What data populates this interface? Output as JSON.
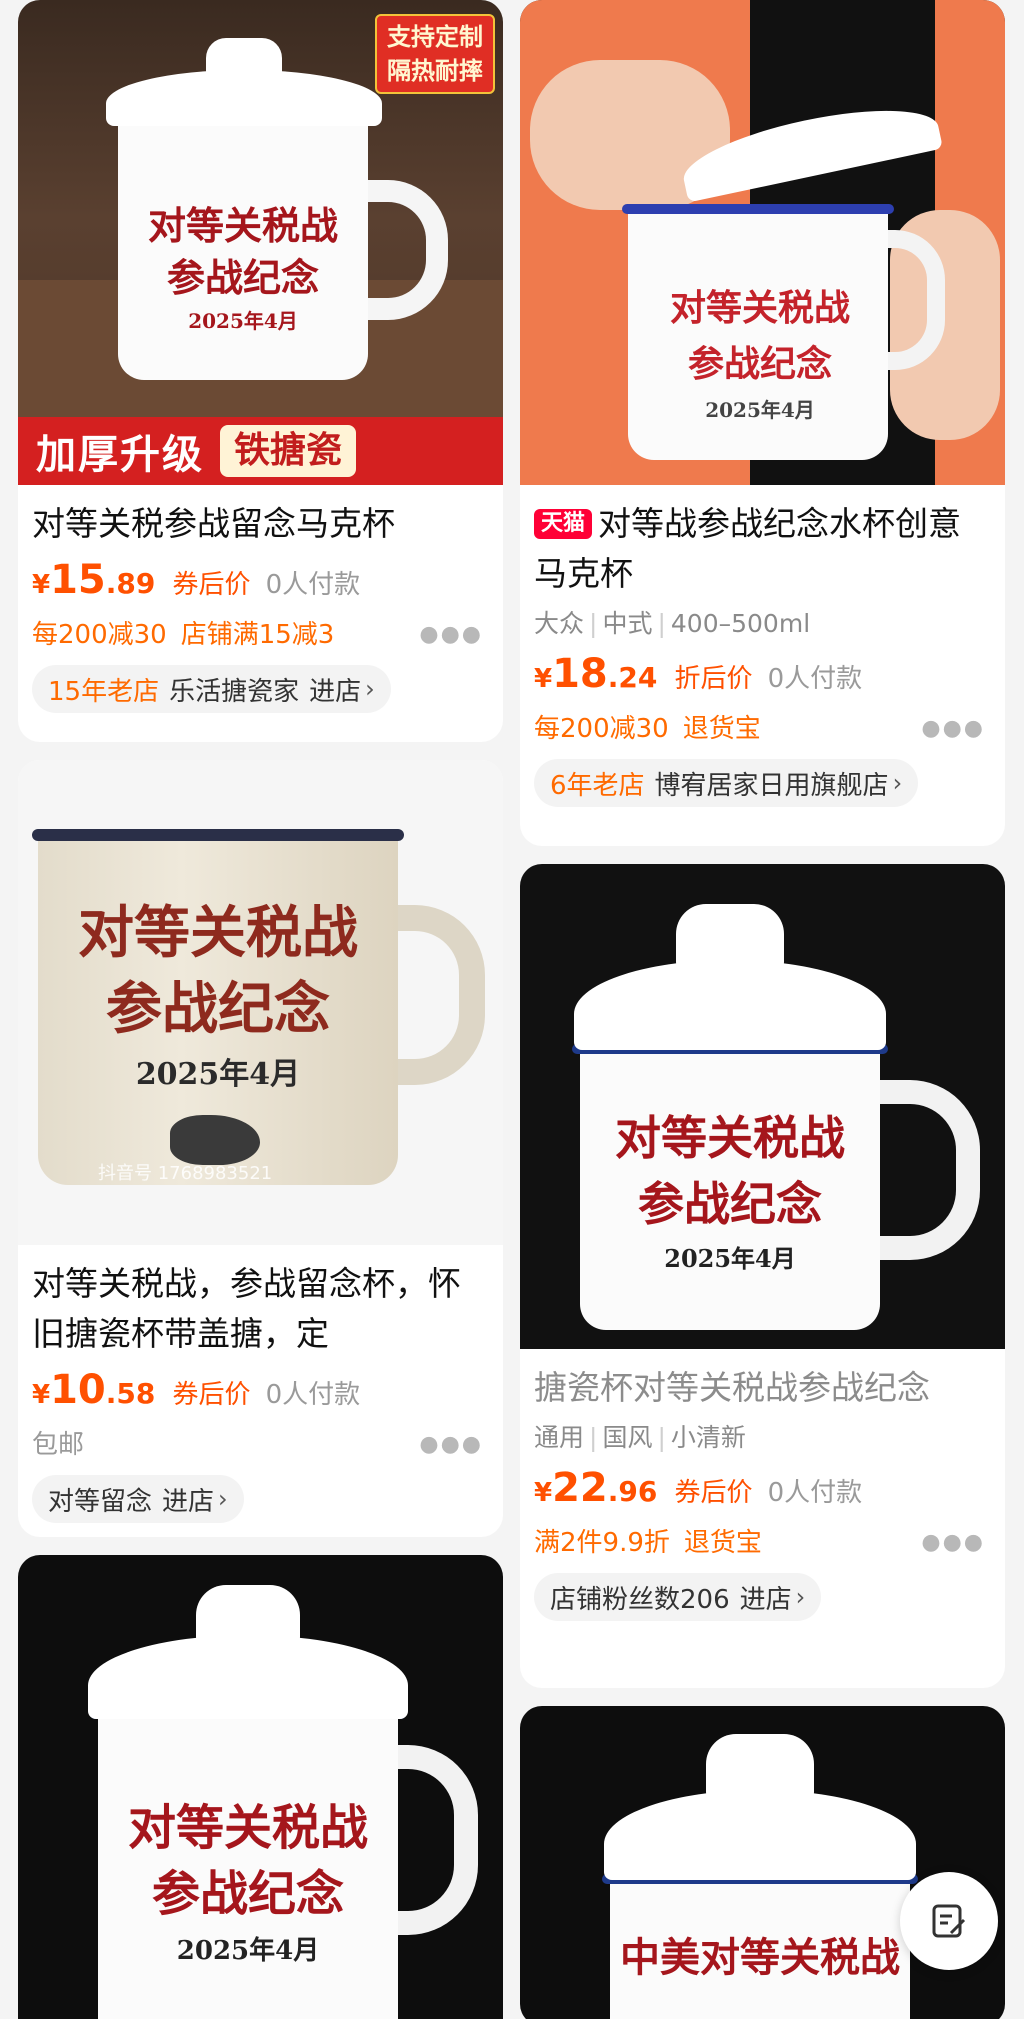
{
  "products": [
    {
      "title": "对等关税参战留念马克杯",
      "image_badge": [
        "支持定制",
        "隔热耐摔"
      ],
      "image_banner": [
        "加厚升级",
        "铁搪瓷"
      ],
      "mug_print": [
        "对等关税战",
        "参战纪念",
        "2025年4月"
      ],
      "price_yen": "¥",
      "price_int": "15",
      "price_dec": ".89",
      "price_label": "券后价",
      "sales": "0人付款",
      "promos": [
        "每200减30",
        "店铺满15减3"
      ],
      "shop_age": "15年老店",
      "shop_name": "乐活搪瓷家",
      "shop_enter": "进店"
    },
    {
      "title": "对等关税战，参战留念杯，怀旧搪瓷杯带盖搪，定",
      "mug_print": [
        "对等关税战",
        "参战纪念",
        "2025年4月"
      ],
      "watermark": "抖音号 1768983521",
      "price_yen": "¥",
      "price_int": "10",
      "price_dec": ".58",
      "price_label": "券后价",
      "sales": "0人付款",
      "promo_gray": "包邮",
      "shop_name": "对等留念",
      "shop_enter": "进店"
    },
    {
      "mug_print": [
        "对等关税战",
        "参战纪念",
        "2025年4月"
      ]
    },
    {
      "tmall_badge": "天猫",
      "title": "对等战参战纪念水杯创意马克杯",
      "tags": [
        "大众",
        "中式",
        "400–500ml"
      ],
      "mug_print": [
        "对等关税战",
        "参战纪念",
        "2025年4月"
      ],
      "price_yen": "¥",
      "price_int": "18",
      "price_dec": ".24",
      "price_label": "折后价",
      "sales": "0人付款",
      "promos": [
        "每200减30",
        "退货宝"
      ],
      "shop_age": "6年老店",
      "shop_name": "博宥居家日用旗舰店",
      "shop_enter": ""
    },
    {
      "title": "搪瓷杯对等关税战参战纪念",
      "tags": [
        "通用",
        "国风",
        "小清新"
      ],
      "mug_print": [
        "对等关税战",
        "参战纪念",
        "2025年4月"
      ],
      "price_yen": "¥",
      "price_int": "22",
      "price_dec": ".96",
      "price_label": "券后价",
      "sales": "0人付款",
      "promos": [
        "满2件9.9折",
        "退货宝"
      ],
      "shop_name": "店铺粉丝数206",
      "shop_enter": "进店"
    },
    {
      "mug_print_partial": "中美对等关税战"
    }
  ],
  "more_icon": "ellipsis-icon",
  "chevron_icon": "chevron-right-icon",
  "float_button_icon": "feedback-edit-icon",
  "colors": {
    "price": "#ff5000",
    "promo": "#ff6a00",
    "tmall": "#ff0036",
    "print": "#a5161c",
    "rim": "#1e3a8a"
  }
}
